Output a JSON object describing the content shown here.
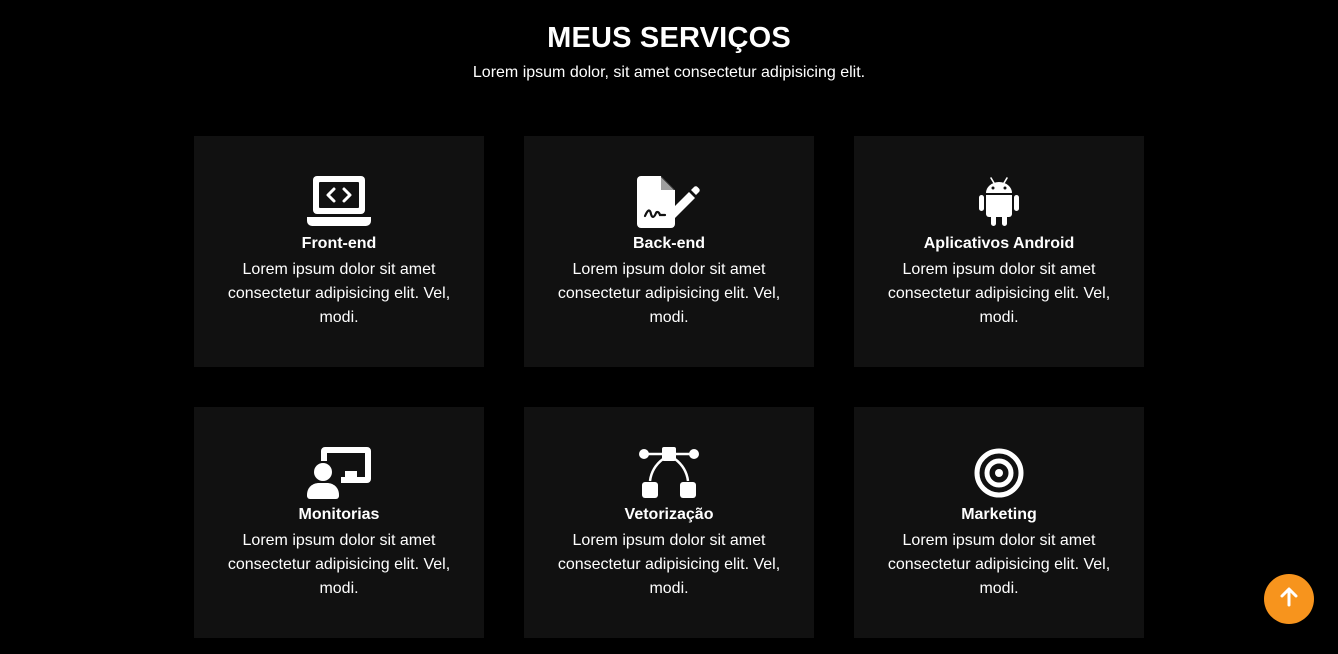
{
  "header": {
    "title": "MEUS SERVIÇOS",
    "subtitle": "Lorem ipsum dolor, sit amet consectetur adipisicing elit."
  },
  "services": [
    {
      "icon": "laptop-code-icon",
      "title": "Front-end",
      "text": "Lorem ipsum dolor sit amet consectetur adipisicing elit. Vel, modi."
    },
    {
      "icon": "file-signature-icon",
      "title": "Back-end",
      "text": "Lorem ipsum dolor sit amet consectetur adipisicing elit. Vel, modi."
    },
    {
      "icon": "android-icon",
      "title": "Aplicativos Android",
      "text": "Lorem ipsum dolor sit amet consectetur adipisicing elit. Vel, modi."
    },
    {
      "icon": "chalkboard-user-icon",
      "title": "Monitorias",
      "text": "Lorem ipsum dolor sit amet consectetur adipisicing elit. Vel, modi."
    },
    {
      "icon": "bezier-curve-icon",
      "title": "Vetorização",
      "text": "Lorem ipsum dolor sit amet consectetur adipisicing elit. Vel, modi."
    },
    {
      "icon": "bullseye-icon",
      "title": "Marketing",
      "text": "Lorem ipsum dolor sit amet consectetur adipisicing elit. Vel, modi."
    }
  ],
  "scroll_top": {
    "icon": "arrow-up-icon"
  },
  "colors": {
    "background": "#000000",
    "card": "#111111",
    "text": "#ffffff",
    "accent": "#f7941d"
  }
}
